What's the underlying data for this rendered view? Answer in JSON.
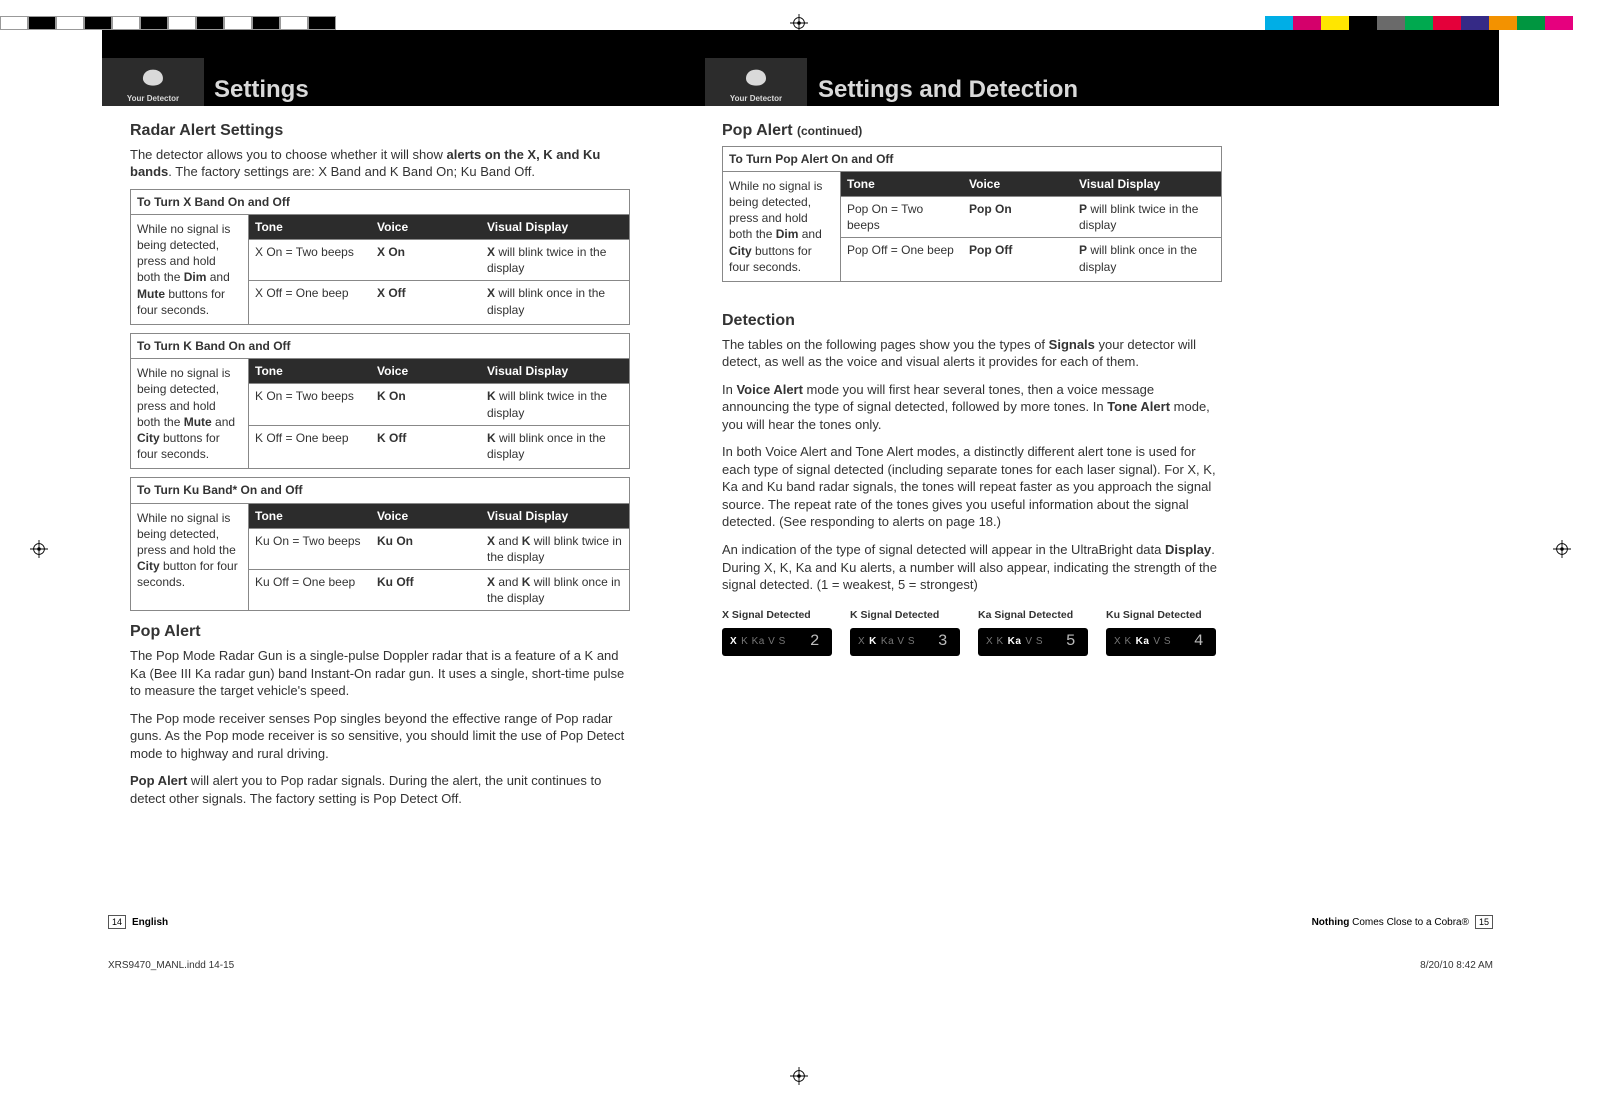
{
  "tabs": {
    "label": "Your Detector"
  },
  "left_title": "Settings",
  "right_title": "Settings and Detection",
  "radar": {
    "headline": "Radar Alert Settings",
    "intro_a": "The detector allows you to choose whether it will show ",
    "intro_b": "alerts on the X, K and Ku bands",
    "intro_c": ". The factory settings are: X Band and K Band On; Ku Band Off.",
    "headers": {
      "tone": "Tone",
      "voice": "Voice",
      "visual": "Visual Display"
    },
    "x": {
      "title": "To Turn X Band On and Off",
      "instr_a": "While no signal is being detected, press and hold both the ",
      "instr_b": "Dim",
      "instr_c": " and ",
      "instr_d": "Mute",
      "instr_e": " buttons for four seconds.",
      "rows": [
        {
          "tone": "X On = Two beeps",
          "voice": "X On",
          "v1": "X",
          "v2": " will blink twice in the display"
        },
        {
          "tone": "X Off = One beep",
          "voice": "X Off",
          "v1": "X",
          "v2": " will blink once in the display"
        }
      ]
    },
    "k": {
      "title": "To Turn K Band On and Off",
      "instr_a": "While no signal is being detected, press and hold both the ",
      "instr_b": "Mute",
      "instr_c": " and ",
      "instr_d": "City",
      "instr_e": " buttons for four seconds.",
      "rows": [
        {
          "tone": "K On = Two beeps",
          "voice": "K On",
          "v1": "K",
          "v2": " will blink twice in the display"
        },
        {
          "tone": "K Off = One beep",
          "voice": "K Off",
          "v1": "K",
          "v2": " will blink once in the display"
        }
      ]
    },
    "ku": {
      "title": "To Turn Ku Band* On and Off",
      "instr_a": "While no signal is being detected, press and hold the ",
      "instr_b": "City",
      "instr_c": " button for four seconds.",
      "rows": [
        {
          "tone": "Ku On = Two beeps",
          "voice": "Ku On",
          "v1": "X",
          "v1b": " and ",
          "v1c": "K",
          "v2": " will blink twice in the display"
        },
        {
          "tone": "Ku Off = One beep",
          "voice": "Ku Off",
          "v1": "X",
          "v1b": " and ",
          "v1c": "K",
          "v2": " will blink once in the display"
        }
      ]
    }
  },
  "pop": {
    "headline": "Pop Alert",
    "p1": "The Pop Mode Radar Gun is a single-pulse Doppler radar that is a feature of a K and Ka (Bee III Ka radar gun) band Instant-On radar gun. It uses a single, short-time pulse to measure the target vehicle's speed.",
    "p2": "The Pop mode receiver senses Pop singles beyond the effective range of Pop radar guns. As the Pop mode receiver is so sensitive, you should limit the use of Pop Detect mode to highway and rural driving.",
    "p3a": "Pop Alert",
    "p3b": " will alert you to Pop radar signals. During the alert, the unit continues to detect other signals. The factory setting is Pop Detect Off."
  },
  "pop2": {
    "headline_a": "Pop Alert ",
    "headline_b": "(continued)",
    "table": {
      "title": "To Turn Pop Alert On and Off",
      "instr_a": "While no signal is being detected, press and hold both the ",
      "instr_b": "Dim",
      "instr_c": " and ",
      "instr_d": "City",
      "instr_e": " buttons for four seconds.",
      "rows": [
        {
          "tone": "Pop On = Two beeps",
          "voice": "Pop On",
          "v1": "P",
          "v2": " will blink twice in the display"
        },
        {
          "tone": "Pop Off = One beep",
          "voice": "Pop Off",
          "v1": "P",
          "v2": " will blink once in the display"
        }
      ]
    }
  },
  "detection": {
    "headline": "Detection",
    "p1a": "The tables on the following pages show you the types of ",
    "p1b": "Signals",
    "p1c": " your detector will detect, as well as the voice and visual alerts it provides for each of them.",
    "p2a": "In ",
    "p2b": "Voice Alert",
    "p2c": " mode you will first hear several tones, then a voice message announcing the type of signal detected, followed by more tones. In ",
    "p2d": "Tone Alert",
    "p2e": " mode, you will hear the tones only.",
    "p3": "In both Voice Alert and Tone Alert modes, a distinctly different alert tone is used for each type of signal detected (including separate tones for each laser signal). For X, K, Ka and Ku band radar signals, the tones will repeat faster as you approach the signal source. The repeat rate of the tones gives you useful information about the signal detected. (See responding to alerts on page 18.)",
    "p4a": "An indication of the type of signal detected will appear in the UltraBright data ",
    "p4b": "Display",
    "p4c": ". During X, K, Ka and Ku alerts, a number will also appear, indicating the strength of the signal detected. (1 = weakest, 5 = strongest)",
    "signals": [
      {
        "label": "X Signal Detected",
        "active": "X",
        "rest": "K Ka V S",
        "num": "2"
      },
      {
        "label": "K Signal Detected",
        "pre": "X ",
        "active": "K",
        "rest": " Ka V S",
        "num": "3"
      },
      {
        "label": "Ka Signal Detected",
        "pre": "X K ",
        "active": "Ka",
        "rest": " V S",
        "num": "5"
      },
      {
        "label": "Ku Signal Detected",
        "pre": "X K ",
        "active": "Ka",
        "rest": " V S",
        "num": "4"
      }
    ]
  },
  "footer": {
    "left_num": "14",
    "left_lang": "English",
    "right_a": "Nothing ",
    "right_b": "Comes Close to a Cobra®",
    "right_num": "15"
  },
  "indd": {
    "file": "XRS9470_MANL.indd   14-15",
    "date": "8/20/10   8:42 AM"
  },
  "colors": {
    "left_bars": [
      "#fff",
      "#000",
      "#fff",
      "#000",
      "#fff",
      "#000",
      "#fff",
      "#000",
      "#fff",
      "#000",
      "#fff",
      "#000"
    ],
    "right_bars": [
      "#00aee6",
      "#d4006b",
      "#ffe600",
      "#000",
      "#6a6a6a",
      "#00a94f",
      "#e4003a",
      "#352a86",
      "#f39200",
      "#009640",
      "#e6007e",
      "#ffffff"
    ]
  }
}
